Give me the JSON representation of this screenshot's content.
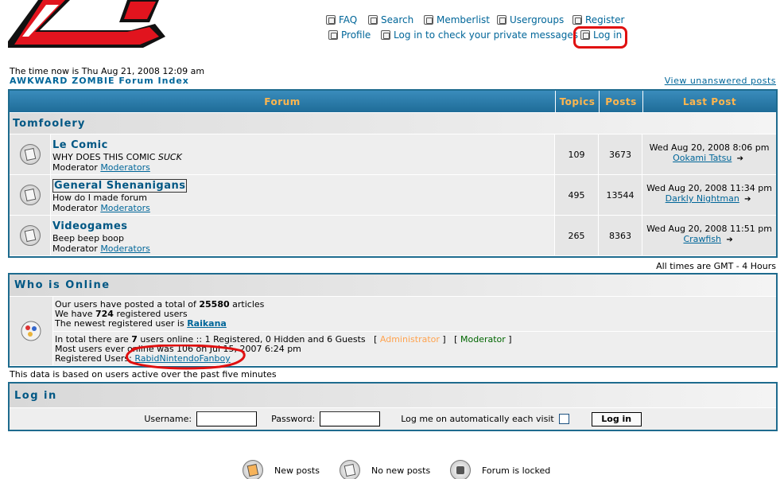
{
  "header": {
    "nav_row1": [
      {
        "name": "faq",
        "label": "FAQ"
      },
      {
        "name": "search",
        "label": "Search"
      },
      {
        "name": "memberlist",
        "label": "Memberlist"
      },
      {
        "name": "usergroups",
        "label": "Usergroups"
      },
      {
        "name": "register",
        "label": "Register"
      }
    ],
    "nav_row2": [
      {
        "name": "profile",
        "label": "Profile"
      },
      {
        "name": "pm",
        "label": "Log in to check your private messages"
      },
      {
        "name": "login",
        "label": "Log in"
      }
    ]
  },
  "time_line": "The time now is Thu Aug 21, 2008 12:09 am",
  "index_link": "AWKWARD ZOMBIE Forum Index",
  "unanswered_link": "View unanswered posts",
  "table": {
    "headers": {
      "forum": "Forum",
      "topics": "Topics",
      "posts": "Posts",
      "last_post": "Last Post"
    },
    "category": "Tomfoolery",
    "moderator_label": "Moderator",
    "rows": [
      {
        "name": "Le Comic",
        "desc": "WHY DOES THIS COMIC ",
        "desc_em": "SUCK",
        "mods": "Moderators",
        "topics": "109",
        "posts": "3673",
        "last_date": "Wed Aug 20, 2008 8:06 pm",
        "last_user": "Ookami Tatsu"
      },
      {
        "name": "General Shenanigans",
        "desc": "How do I made forum",
        "desc_em": "",
        "mods": "Moderators",
        "topics": "495",
        "posts": "13544",
        "last_date": "Wed Aug 20, 2008 11:34 pm",
        "last_user": "Darkly Nightman"
      },
      {
        "name": "Videogames",
        "desc": "Beep beep boop",
        "desc_em": "",
        "mods": "Moderators",
        "topics": "265",
        "posts": "8363",
        "last_date": "Wed Aug 20, 2008 11:51 pm",
        "last_user": "Crawfish"
      }
    ]
  },
  "gmt_note": "All times are GMT - 4 Hours",
  "who": {
    "title": "Who is Online",
    "l1a": "Our users have posted a total of ",
    "l1b": "25580",
    "l1c": " articles",
    "l2a": "We have ",
    "l2b": "724",
    "l2c": " registered users",
    "l3a": "The newest registered user is ",
    "l3b": "Raikana",
    "l4a": "In total there are ",
    "l4b": "7",
    "l4c": " users online :: 1 Registered, 0 Hidden and 6 Guests   [ ",
    "admin": "Administrator",
    "l4d": " ]   [ ",
    "moderator": "Moderator",
    "l4e": " ]",
    "l5": "Most users ever online was 106 on Jul 15, 2007 6:24 pm",
    "l6a": "Registered Users: ",
    "l6b": "RabidNintendoFanboy"
  },
  "based_note": "This data is based on users active over the past five minutes",
  "login": {
    "title": "Log in",
    "username_label": "Username:",
    "password_label": "Password:",
    "auto_label": "Log me on automatically each visit",
    "button": "Log in"
  },
  "legend": {
    "new_posts": "New posts",
    "no_new": "No new posts",
    "locked": "Forum is locked"
  }
}
